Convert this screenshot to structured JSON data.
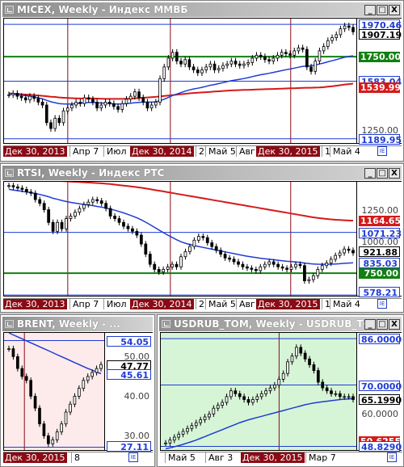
{
  "colors": {
    "blue": "#1f3cd4",
    "green": "#108010",
    "red": "#d41a1a",
    "darkred": "#8b0a14",
    "pink_bg": "#fdeaea",
    "green_bg": "#d6f5d6"
  },
  "windows": {
    "micex": {
      "title": "MICEX, Weekly - Индекс ММВБ",
      "buttons": [
        "_",
        "□",
        "X"
      ],
      "time_labels": [
        "Дек 30, 2013",
        "Апр 7",
        "Июл",
        "Дек 30, 2014",
        "2",
        "Май 5",
        "Авг",
        "Дек 30, 2015",
        "1",
        "Май 4"
      ],
      "tags": [
        {
          "text": "1970.46",
          "style": "blue"
        },
        {
          "text": "1907.19",
          "style": "black"
        },
        {
          "text": "1750.00",
          "style": "green"
        },
        {
          "text": "1583.04",
          "style": "blue"
        },
        {
          "text": "1539.99",
          "style": "red"
        },
        {
          "text": "1250.00",
          "style": "plain"
        },
        {
          "text": "1189.95",
          "style": "blue"
        }
      ],
      "chart_data": {
        "type": "line",
        "ylim": [
          1150,
          2010
        ],
        "hlines": [
          {
            "value": 1970.46,
            "color": "blue"
          },
          {
            "value": 1750.0,
            "color": "green"
          },
          {
            "value": 1583.04,
            "color": "blue"
          },
          {
            "value": 1189.95,
            "color": "blue"
          }
        ],
        "price": [
          1490,
          1500,
          1480,
          1470,
          1455,
          1480,
          1465,
          1440,
          1420,
          1300,
          1260,
          1330,
          1300,
          1380,
          1400,
          1420,
          1440,
          1430,
          1470,
          1460,
          1440,
          1400,
          1420,
          1440,
          1430,
          1410,
          1390,
          1430,
          1460,
          1480,
          1510,
          1470,
          1440,
          1400,
          1420,
          1440,
          1600,
          1680,
          1740,
          1780,
          1720,
          1700,
          1730,
          1680,
          1660,
          1640,
          1660,
          1680,
          1700,
          1660,
          1670,
          1690,
          1700,
          1720,
          1700,
          1690,
          1700,
          1710,
          1740,
          1760,
          1750,
          1730,
          1720,
          1740,
          1760,
          1780,
          1770,
          1760,
          1790,
          1810,
          1800,
          1680,
          1650,
          1720,
          1790,
          1820,
          1860,
          1880,
          1900,
          1940,
          1960,
          1950,
          1920
        ],
        "ma_blue": [
          1495,
          1493,
          1490,
          1487,
          1484,
          1480,
          1475,
          1470,
          1462,
          1452,
          1442,
          1436,
          1430,
          1428,
          1427,
          1428,
          1430,
          1432,
          1435,
          1437,
          1438,
          1436,
          1434,
          1432,
          1430,
          1428,
          1427,
          1428,
          1430,
          1433,
          1436,
          1438,
          1440,
          1440,
          1440,
          1442,
          1450,
          1460,
          1472,
          1485,
          1495,
          1505,
          1515,
          1523,
          1530,
          1535,
          1541,
          1548,
          1555,
          1560,
          1567,
          1573,
          1580,
          1586,
          1591,
          1596,
          1601,
          1607,
          1614,
          1621,
          1627,
          1632,
          1637,
          1643,
          1649,
          1655,
          1661,
          1666,
          1672,
          1678,
          1684,
          1686,
          1688,
          1693,
          1700,
          1707,
          1715,
          1722,
          1730,
          1738,
          1746,
          1752,
          1756
        ],
        "ma_red": [
          1500,
          1498,
          1496,
          1494,
          1492,
          1490,
          1488,
          1486,
          1483,
          1480,
          1477,
          1475,
          1472,
          1470,
          1468,
          1467,
          1466,
          1465,
          1465,
          1465,
          1465,
          1464,
          1463,
          1462,
          1462,
          1462,
          1462,
          1462,
          1463,
          1464,
          1466,
          1468,
          1470,
          1472,
          1474,
          1476,
          1479,
          1482,
          1485,
          1488,
          1491,
          1494,
          1497,
          1500,
          1502,
          1504,
          1506,
          1508,
          1510,
          1512,
          1514,
          1516,
          1518,
          1520,
          1521,
          1522,
          1523,
          1524,
          1525,
          1526,
          1527,
          1528,
          1529,
          1530,
          1531,
          1532,
          1533,
          1534,
          1535,
          1536,
          1537,
          1538,
          1538,
          1539,
          1540,
          1542,
          1545,
          1548,
          1552,
          1556,
          1560,
          1563,
          1566
        ],
        "vlines": [
          0.18,
          0.47,
          0.81
        ]
      }
    },
    "rtsi": {
      "title": "RTSI, Weekly - Индекс РТС",
      "buttons": [
        "_",
        "□",
        "X"
      ],
      "time_labels": [
        "Дек 30, 2013",
        "Апр 7",
        "Июл",
        "Дек 30, 2014",
        "2",
        "Май 5",
        "Авг",
        "Дек 30, 2015",
        "1",
        "Май 4"
      ],
      "tags": [
        {
          "text": "1250.00",
          "style": "plain"
        },
        {
          "text": "1164.65",
          "style": "red"
        },
        {
          "text": "1071.23",
          "style": "blue"
        },
        {
          "text": "1000.00",
          "style": "plain"
        },
        {
          "text": "921.88",
          "style": "black"
        },
        {
          "text": "835.03",
          "style": "blue"
        },
        {
          "text": "750.00",
          "style": "green"
        },
        {
          "text": "578.21",
          "style": "blue"
        }
      ],
      "chart_data": {
        "type": "line",
        "ylim": [
          560,
          1470
        ],
        "hlines": [
          {
            "value": 1071.23,
            "color": "blue"
          },
          {
            "value": 750.0,
            "color": "green"
          },
          {
            "value": 578.21,
            "color": "blue"
          }
        ],
        "price": [
          1440,
          1430,
          1420,
          1410,
          1390,
          1380,
          1330,
          1300,
          1250,
          1150,
          1080,
          1150,
          1100,
          1180,
          1200,
          1230,
          1260,
          1290,
          1310,
          1330,
          1320,
          1300,
          1260,
          1200,
          1180,
          1150,
          1120,
          1100,
          1080,
          1050,
          980,
          900,
          820,
          780,
          760,
          780,
          800,
          820,
          800,
          880,
          920,
          960,
          1010,
          1040,
          1030,
          990,
          960,
          930,
          900,
          870,
          860,
          840,
          820,
          800,
          790,
          780,
          770,
          800,
          820,
          840,
          820,
          800,
          790,
          780,
          800,
          820,
          810,
          690,
          700,
          730,
          780,
          810,
          830,
          860,
          890,
          910,
          940,
          930,
          910
        ],
        "ma_blue": [
          1410,
          1405,
          1400,
          1395,
          1390,
          1384,
          1377,
          1370,
          1362,
          1352,
          1340,
          1332,
          1323,
          1315,
          1308,
          1302,
          1297,
          1292,
          1287,
          1282,
          1276,
          1270,
          1263,
          1255,
          1246,
          1236,
          1225,
          1213,
          1200,
          1186,
          1170,
          1152,
          1132,
          1111,
          1090,
          1070,
          1050,
          1032,
          1014,
          998,
          986,
          976,
          968,
          960,
          953,
          946,
          939,
          932,
          925,
          918,
          911,
          904,
          897,
          890,
          884,
          878,
          873,
          868,
          864,
          860,
          856,
          852,
          848,
          844,
          841,
          838,
          835,
          830,
          826,
          823,
          821,
          820,
          820,
          821,
          823,
          825,
          828,
          830,
          832
        ],
        "ma_red": [
          1500,
          1498,
          1496,
          1494,
          1492,
          1490,
          1488,
          1486,
          1484,
          1482,
          1480,
          1478,
          1476,
          1474,
          1472,
          1470,
          1468,
          1466,
          1464,
          1462,
          1460,
          1458,
          1455,
          1452,
          1448,
          1444,
          1440,
          1436,
          1432,
          1428,
          1423,
          1418,
          1412,
          1406,
          1400,
          1394,
          1388,
          1382,
          1376,
          1370,
          1364,
          1358,
          1352,
          1346,
          1340,
          1334,
          1328,
          1322,
          1316,
          1310,
          1304,
          1298,
          1292,
          1286,
          1280,
          1274,
          1268,
          1262,
          1256,
          1250,
          1244,
          1238,
          1232,
          1226,
          1220,
          1214,
          1208,
          1202,
          1196,
          1190,
          1185,
          1181,
          1177,
          1174,
          1171,
          1169,
          1167,
          1165,
          1164
        ],
        "vlines": [
          0.18,
          0.47,
          0.81
        ]
      }
    },
    "brent": {
      "title": "BRENT, Weekly - ...",
      "buttons": [
        "_",
        "□",
        "X"
      ],
      "time_labels": [
        "Дек 30, 2015",
        "8"
      ],
      "tags": [
        {
          "text": "54.05",
          "style": "blue"
        },
        {
          "text": "50.00",
          "style": "plain"
        },
        {
          "text": "47.77",
          "style": "black"
        },
        {
          "text": "45.61",
          "style": "blue"
        },
        {
          "text": "40.00",
          "style": "plain"
        },
        {
          "text": "30.00",
          "style": "plain"
        },
        {
          "text": "27.11",
          "style": "blue"
        }
      ],
      "chart_data": {
        "type": "line",
        "ylim": [
          26,
          56
        ],
        "hlines": [
          {
            "value": 54.05,
            "color": "blue"
          },
          {
            "value": 27.11,
            "color": "blue"
          }
        ],
        "price": [
          52,
          50,
          47,
          45,
          44,
          40,
          37,
          33,
          30,
          28,
          29,
          31,
          33,
          36,
          38,
          40,
          42,
          44,
          45,
          46,
          47,
          48
        ],
        "ma_blue": [
          56,
          55.5,
          55,
          54.5,
          54,
          53.5,
          53,
          52.5,
          52,
          51.5,
          51,
          50.5,
          50,
          49.5,
          49,
          48.5,
          48,
          47.5,
          47,
          46.6,
          46.1,
          45.7
        ],
        "vlines": [
          0.2
        ]
      }
    },
    "usdrub": {
      "title": "USDRUB_TOM, Weekly - USDRUB_TOM",
      "buttons": [
        "_",
        "□",
        "X"
      ],
      "time_labels": [
        "Май 5",
        "Авг 3",
        "Дек 30, 2015",
        "Мар 7"
      ],
      "tags": [
        {
          "text": "86.0000",
          "style": "blue"
        },
        {
          "text": "70.0000",
          "style": "blue"
        },
        {
          "text": "65.1990",
          "style": "black"
        },
        {
          "text": "60.0000",
          "style": "plain"
        },
        {
          "text": "50.6255",
          "style": "red"
        },
        {
          "text": "48.8290",
          "style": "blue"
        }
      ],
      "chart_data": {
        "type": "line",
        "ylim": [
          47,
          88
        ],
        "hlines": [
          {
            "value": 86.0,
            "color": "blue"
          },
          {
            "value": 70.0,
            "color": "blue"
          },
          {
            "value": 48.829,
            "color": "blue"
          }
        ],
        "price": [
          50,
          51,
          52,
          53,
          54,
          55,
          56,
          57,
          58,
          59,
          60,
          62,
          63,
          64,
          66,
          68,
          67,
          66,
          65,
          64,
          65,
          66,
          67,
          68,
          69,
          70,
          72,
          74,
          78,
          80,
          83,
          81,
          79,
          77,
          75,
          71,
          69,
          68,
          67,
          67,
          66,
          66,
          66,
          65
        ],
        "ma_blue": [
          48,
          48.3,
          48.7,
          49.1,
          49.5,
          50,
          50.5,
          51,
          51.6,
          52.2,
          52.8,
          53.4,
          54,
          54.6,
          55.2,
          55.8,
          56.4,
          57,
          57.5,
          58,
          58.4,
          58.8,
          59.2,
          59.6,
          60,
          60.4,
          60.8,
          61.2,
          61.6,
          62,
          62.4,
          62.8,
          63.2,
          63.5,
          63.8,
          64,
          64.2,
          64.4,
          64.6,
          64.8,
          65,
          65.1,
          65.2,
          65.3
        ],
        "vlines": [
          0.6
        ]
      }
    }
  }
}
